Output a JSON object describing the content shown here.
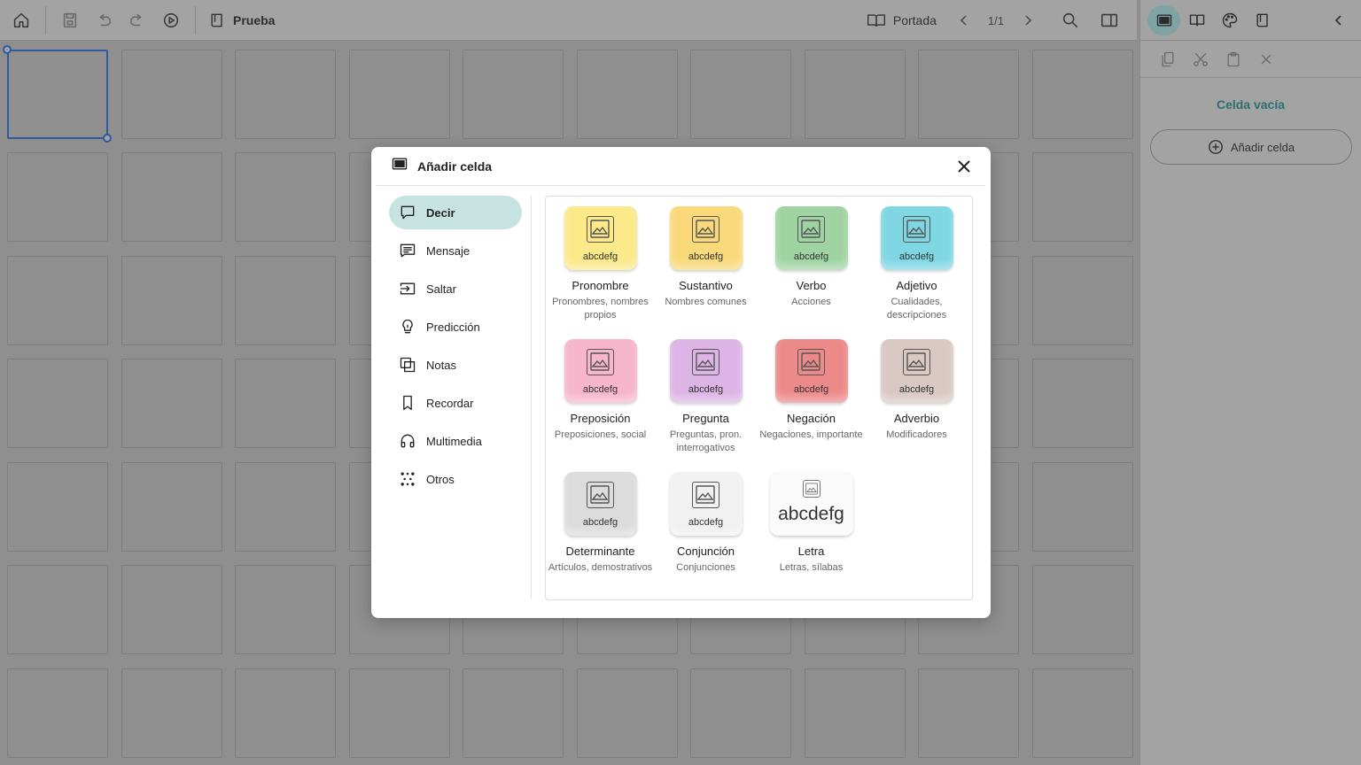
{
  "toolbar": {
    "book_title": "Prueba",
    "portada_label": "Portada",
    "page_indicator": "1/1"
  },
  "right_panel": {
    "empty_cell_label": "Celda vacía",
    "add_cell_label": "Añadir celda"
  },
  "modal": {
    "title": "Añadir celda",
    "nav": [
      {
        "label": "Decir",
        "icon": "speech-bubble-icon",
        "active": true
      },
      {
        "label": "Mensaje",
        "icon": "message-icon"
      },
      {
        "label": "Saltar",
        "icon": "jump-icon"
      },
      {
        "label": "Predicción",
        "icon": "lightbulb-icon"
      },
      {
        "label": "Notas",
        "icon": "notes-icon"
      },
      {
        "label": "Recordar",
        "icon": "bookmark-icon"
      },
      {
        "label": "Multimedia",
        "icon": "headphones-icon"
      },
      {
        "label": "Otros",
        "icon": "dots-icon"
      }
    ],
    "cards": [
      {
        "name": "Pronombre",
        "desc": "Pronombres, nombres propios",
        "color": "#fbe98a",
        "sample": "abcdefg"
      },
      {
        "name": "Sustantivo",
        "desc": "Nombres comunes",
        "color": "#f9d97a",
        "sample": "abcdefg"
      },
      {
        "name": "Verbo",
        "desc": "Acciones",
        "color": "#9fd4a2",
        "sample": "abcdefg"
      },
      {
        "name": "Adjetivo",
        "desc": "Cualidades, descripciones",
        "color": "#7fd7e4",
        "sample": "abcdefg"
      },
      {
        "name": "Preposición",
        "desc": "Preposiciones, social",
        "color": "#f7b6cc",
        "sample": "abcdefg"
      },
      {
        "name": "Pregunta",
        "desc": "Preguntas, pron. interrogativos",
        "color": "#dcb5e6",
        "sample": "abcdefg"
      },
      {
        "name": "Negación",
        "desc": "Negaciones, importante",
        "color": "#ec8a8a",
        "sample": "abcdefg"
      },
      {
        "name": "Adverbio",
        "desc": "Modificadores",
        "color": "#d9c8c4",
        "sample": "abcdefg"
      },
      {
        "name": "Determinante",
        "desc": "Artículos, demostrativos",
        "color": "#dcdcdc",
        "sample": "abcdefg"
      },
      {
        "name": "Conjunción",
        "desc": "Conjunciones",
        "color": "#f1f1f1",
        "sample": "abcdefg"
      },
      {
        "name": "Letra",
        "desc": "Letras, sílabas",
        "color": "#fafafa",
        "sample": "abcdefg"
      }
    ]
  }
}
